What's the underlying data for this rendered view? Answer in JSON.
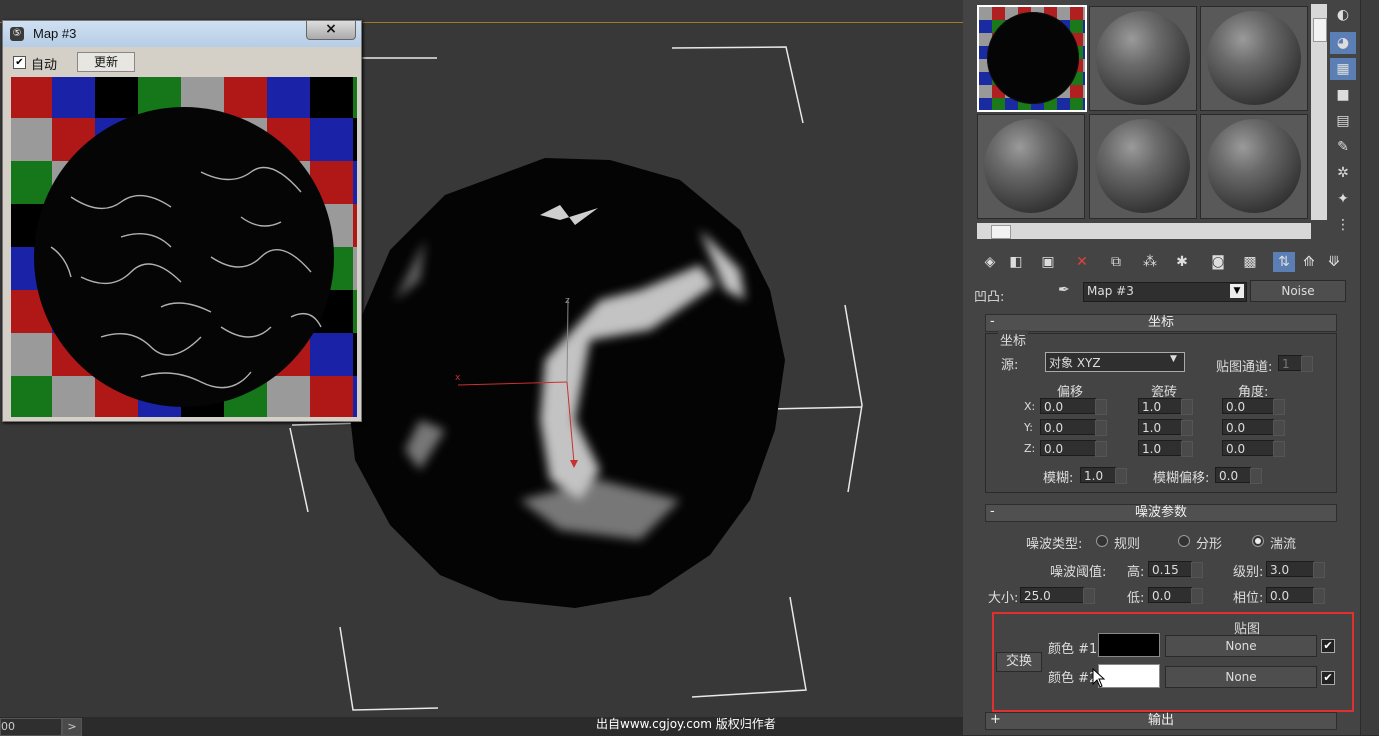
{
  "map_window": {
    "title": "Map #3",
    "close_glyph": "×",
    "auto_label": "自动",
    "auto_checked": true,
    "update_label": "更新"
  },
  "viewport": {
    "axis_x": "x",
    "axis_z": "z"
  },
  "material_editor": {
    "bump_label": "凹凸:",
    "map_name": "Map #3",
    "map_type": "Noise",
    "coordinates": {
      "header": "坐标",
      "group_label": "坐标",
      "source_label": "源:",
      "source_value": "对象 XYZ",
      "map_channel_label": "贴图通道:",
      "map_channel_value": "1",
      "col_offset": "偏移",
      "col_tiling": "瓷砖",
      "col_angle": "角度:",
      "row_x": "X:",
      "row_y": "Y:",
      "row_z": "Z:",
      "offset": [
        "0.0",
        "0.0",
        "0.0"
      ],
      "tiling": [
        "1.0",
        "1.0",
        "1.0"
      ],
      "angle": [
        "0.0",
        "0.0",
        "0.0"
      ],
      "blur_label": "模糊:",
      "blur_value": "1.0",
      "blur_offset_label": "模糊偏移:",
      "blur_offset_value": "0.0"
    },
    "noise": {
      "header": "噪波参数",
      "type_label": "噪波类型:",
      "types": [
        "规则",
        "分形",
        "湍流"
      ],
      "selected_type": "湍流",
      "threshold_label": "噪波阈值:",
      "high_label": "高:",
      "high_value": "0.15",
      "levels_label": "级别:",
      "levels_value": "3.0",
      "size_label": "大小:",
      "size_value": "25.0",
      "low_label": "低:",
      "low_value": "0.0",
      "phase_label": "相位:",
      "phase_value": "0.0",
      "maps_label": "贴图",
      "swap_label": "交换",
      "color1_label": "颜色 #1",
      "color1": "#000000",
      "color2_label": "颜色 #2",
      "color2": "#ffffff",
      "map1": "None",
      "map2": "None"
    },
    "output_header": "输出",
    "collapse_minus": "-",
    "expand_plus": "+"
  },
  "statusbar": {
    "frame_value": "00",
    "arrow": ">",
    "watermark": "出自www.cgjoy.com 版权归作者"
  },
  "colors": {
    "highlight": "#e03030",
    "viewport_bg": "#383838",
    "panel_bg": "#444444"
  }
}
